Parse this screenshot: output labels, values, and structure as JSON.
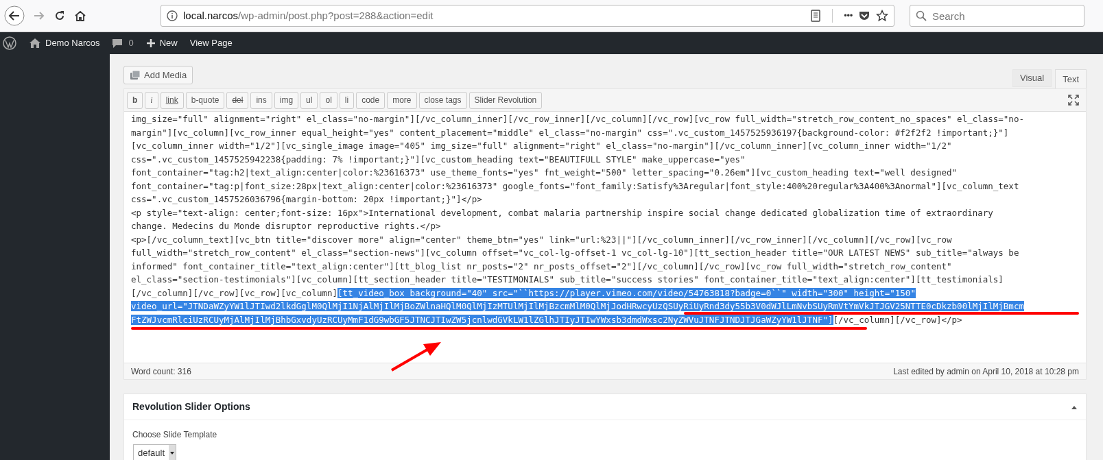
{
  "browser": {
    "url_host": "local.narcos",
    "url_path": "/wp-admin/post.php?post=288&action=edit",
    "more": "•••",
    "search": {
      "placeholder": "Search"
    }
  },
  "admin_bar": {
    "site": "Demo Narcos",
    "comments": "0",
    "new": "New",
    "view": "View Page"
  },
  "editor": {
    "add_media": "Add Media",
    "tabs": [
      {
        "label": "Visual",
        "selected": false
      },
      {
        "label": "Text",
        "selected": true
      }
    ],
    "toolbar": [
      {
        "label": "b",
        "kind": "bold"
      },
      {
        "label": "i",
        "kind": "italic"
      },
      {
        "label": "link",
        "kind": "underline"
      },
      {
        "label": "b-quote",
        "kind": "plain"
      },
      {
        "label": "del",
        "kind": "strike"
      },
      {
        "label": "ins",
        "kind": "plain"
      },
      {
        "label": "img",
        "kind": "plain"
      },
      {
        "label": "ul",
        "kind": "plain"
      },
      {
        "label": "ol",
        "kind": "plain"
      },
      {
        "label": "li",
        "kind": "plain"
      },
      {
        "label": "code",
        "kind": "plain"
      },
      {
        "label": "more",
        "kind": "plain"
      },
      {
        "label": "close tags",
        "kind": "plain"
      },
      {
        "label": "Slider Revolution",
        "kind": "plain"
      }
    ],
    "lines": [
      [
        {
          "text": "img_size=\"full\" alignment=\"right\" el_class=\"no-margin\"][/vc_column_inner][/vc_row_inner][/vc_column][/vc_row][vc_row full_width=\"stretch_row_content_no_spaces\" el_class=\"no-",
          "selected": false
        }
      ],
      [
        {
          "text": "margin\"][vc_column][vc_row_inner equal_height=\"yes\" content_placement=\"middle\" el_class=\"no-margin\" css=\".vc_custom_1457525936197{background-color: #f2f2f2 !important;}\"]",
          "selected": false
        }
      ],
      [
        {
          "text": "[vc_column_inner width=\"1/2\"][vc_single_image image=\"405\" img_size=\"full\" alignment=\"right\" el_class=\"no-margin\"][/vc_column_inner][vc_column_inner width=\"1/2\"",
          "selected": false
        }
      ],
      [
        {
          "text": "css=\".vc_custom_1457525942238{padding: 7% !important;}\"][vc_custom_heading text=\"BEAUTIFULL STYLE\" make_uppercase=\"yes\"",
          "selected": false
        }
      ],
      [
        {
          "text": "font_container=\"tag:h2|text_align:center|color:%23616373\" use_theme_fonts=\"yes\" fnt_weight=\"500\" letter_spacing=\"0.26em\"][vc_custom_heading text=\"well designed\"",
          "selected": false
        }
      ],
      [
        {
          "text": "font_container=\"tag:p|font_size:28px|text_align:center|color:%23616373\" google_fonts=\"font_family:Satisfy%3Aregular|font_style:400%20regular%3A400%3Anormal\"][vc_column_text",
          "selected": false
        }
      ],
      [
        {
          "text": "css=\".vc_custom_1457526036796{margin-bottom: 20px !important;}\"]</p>",
          "selected": false
        }
      ],
      [
        {
          "text": "<p style=\"text-align: center;font-size: 16px\">International development, combat malaria partnership inspire social change dedicated globalization time of extraordinary",
          "selected": false
        }
      ],
      [
        {
          "text": "change. Medecins du Monde disruptor reproductive rights.</p>",
          "selected": false
        }
      ],
      [
        {
          "text": "<p>[/vc_column_text][vc_btn title=\"discover more\" align=\"center\" theme_btn=\"yes\" link=\"url:%23||\"][/vc_column_inner][/vc_row_inner][/vc_column][/vc_row][vc_row",
          "selected": false
        }
      ],
      [
        {
          "text": "full_width=\"stretch_row_content\" el_class=\"section-news\"][vc_column offset=\"vc_col-lg-offset-1 vc_col-lg-10\"][tt_section_header title=\"OUR LATEST NEWS\" sub_title=\"always be",
          "selected": false
        }
      ],
      [
        {
          "text": "informed\" font_container_title=\"text_align:center\"][tt_blog_list nr_posts=\"2\" nr_posts_offset=\"2\"][/vc_column][/vc_row][vc_row full_width=\"stretch_row_content\"",
          "selected": false
        }
      ],
      [
        {
          "text": "el_class=\"section-testimonials\"][vc_column][tt_section_header title=\"TESTIMONIALS\" sub_title=\"success stories\" font_container_title=\"text_align:center\"][tt_testimonials]",
          "selected": false
        }
      ],
      [
        {
          "text": "[/vc_column][/vc_row][vc_row][vc_column]",
          "selected": false
        },
        {
          "text": "[tt_video_box background=\"40\" src=\"``https://player.vimeo.com/video/54763818?badge=0``\" width=\"300\" height=\"150\"",
          "selected": true
        }
      ],
      [
        {
          "text": "video_url=\"JTNDaWZyYW1lJTIwd2lkdGglM0QlMjI1NjAlMjIlMjBoZWlnaHQlM0QlMjIzMTUlMjIlMjBzcmMlM0QlMjJodHRwcyUzQSUyRiUyRnd3dy55b3V0dWJlLmNvbSUyRmVtYmVkJTJGV25NTTE0cDkzb00lMjIlMjBmcm",
          "selected": true
        }
      ],
      [
        {
          "text": "FtZWJvcmRlciUzRCUyMjAlMjIlMjBhbGxvdyUzRCUyMmF1dG9wbGF5JTNCJTIwZW5jcnlwdGVkLW1lZGlhJTIyJTIwYWxsb3dmdWxsc2NyZWVuJTNFJTNDJTJGaWZyYW1lJTNF\"]",
          "selected": true
        },
        {
          "text": "[/vc_column][/vc_row]</p>",
          "selected": false
        }
      ]
    ],
    "word_count": "Word count: 316",
    "last_edited": "Last edited by admin on April 10, 2018 at 10:28 pm"
  },
  "slider_options": {
    "title": "Revolution Slider Options",
    "label": "Choose Slide Template",
    "select": "default"
  }
}
